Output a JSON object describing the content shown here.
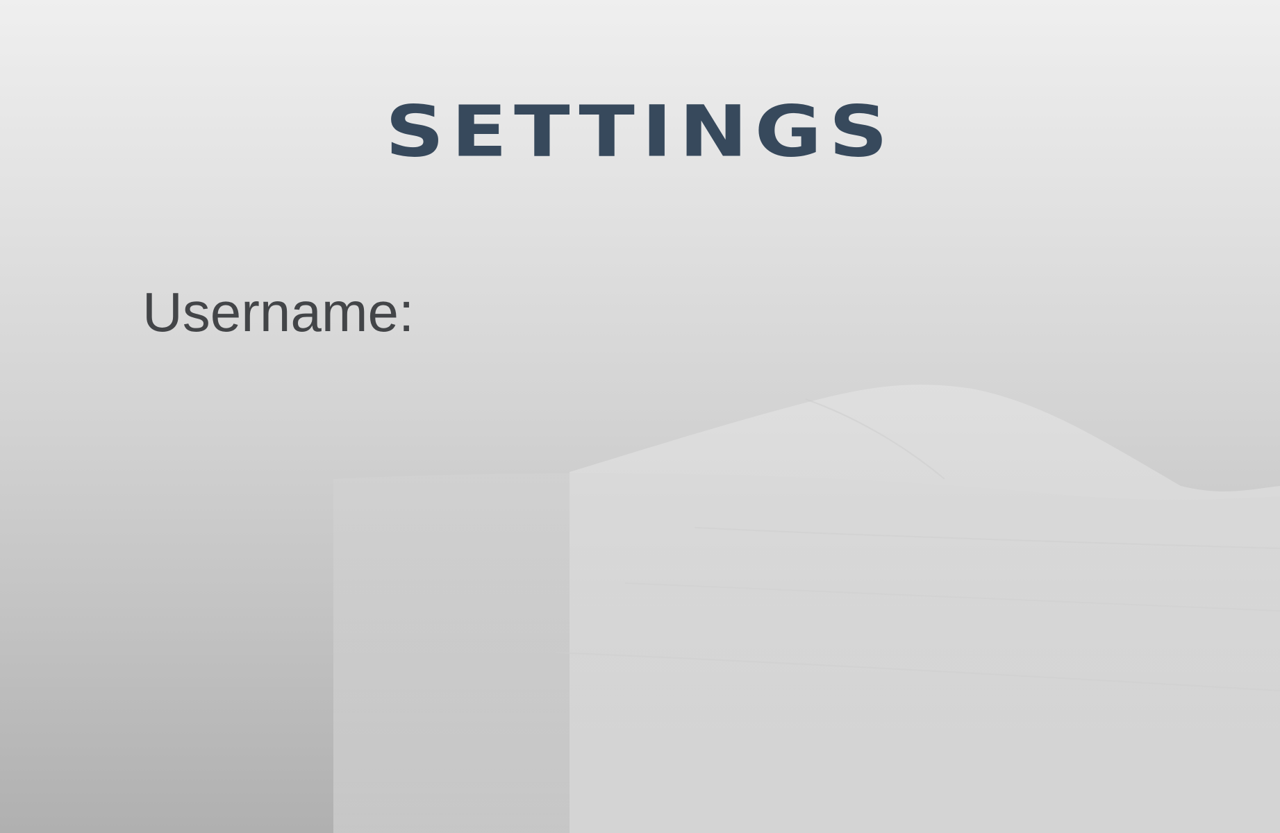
{
  "page": {
    "title": "SETTINGS"
  },
  "form": {
    "username_label": "Username:"
  },
  "colors": {
    "title": "#37495c",
    "label": "#434548",
    "background_top": "#efefef",
    "background_bottom": "#b0b0b0"
  },
  "background": {
    "icon": "snowy-hill-landscape"
  }
}
